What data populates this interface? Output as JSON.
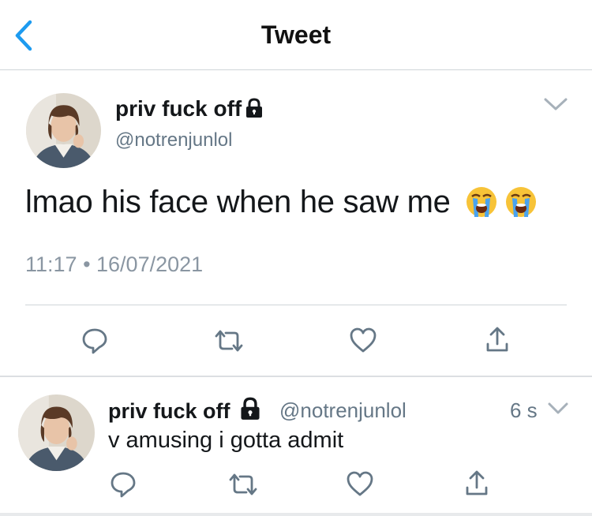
{
  "header": {
    "title": "Tweet",
    "back_icon": "chevron-left-icon"
  },
  "colors": {
    "accent": "#1d9bf0",
    "text": "#14171a",
    "secondary": "#657786",
    "divider": "#cfd4d8"
  },
  "tweet": {
    "display_name": "priv fuck off",
    "lock_icon": "lock-icon",
    "handle": "@notrenjunlol",
    "text": "lmao his face when he saw me",
    "emojis": [
      "loudly-crying-face",
      "loudly-crying-face"
    ],
    "timestamp": "11:17 • 16/07/2021",
    "actions": [
      "reply-icon",
      "retweet-icon",
      "like-icon",
      "share-icon"
    ]
  },
  "reply": {
    "display_name": "priv fuck off",
    "lock_icon": "lock-icon",
    "handle": "@notrenjunlol",
    "time": "6 s",
    "text": "v amusing i gotta admit",
    "actions": [
      "reply-icon",
      "retweet-icon",
      "like-icon",
      "share-icon"
    ]
  }
}
